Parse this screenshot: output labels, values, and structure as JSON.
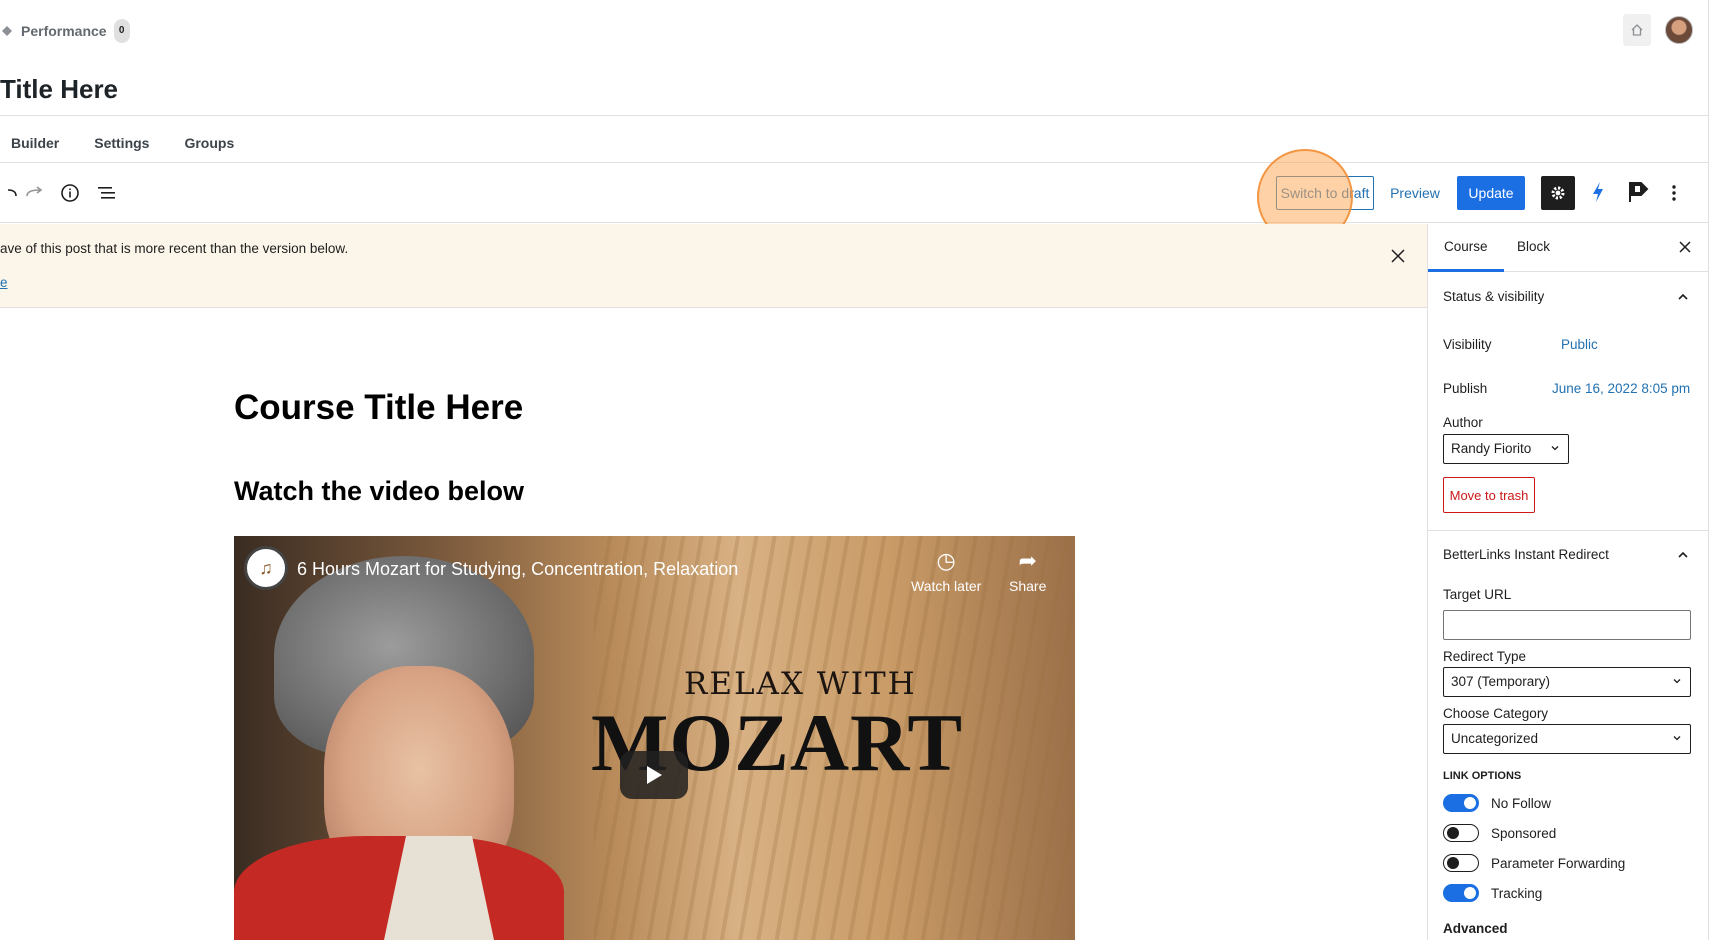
{
  "admin_bar": {
    "performance_label": "Performance",
    "performance_count": "0"
  },
  "page": {
    "title": "Title Here"
  },
  "tabs": [
    "Builder",
    "Settings",
    "Groups"
  ],
  "toolbar": {
    "switch_to_draft": "Switch to draft",
    "preview": "Preview",
    "update": "Update"
  },
  "notice": {
    "message": "ave of this post that is more recent than the version below.",
    "link": "e"
  },
  "content": {
    "heading": "Course Title Here",
    "subheading": "Watch the video below",
    "video": {
      "title": "6 Hours Mozart for Studying, Concentration, Relaxation",
      "watch_later": "Watch later",
      "share": "Share",
      "thumbnail_line1": "RELAX WITH",
      "thumbnail_line2": "MOZART"
    }
  },
  "sidebar": {
    "tabs": {
      "course": "Course",
      "block": "Block"
    },
    "status": {
      "heading": "Status & visibility",
      "visibility_label": "Visibility",
      "visibility_value": "Public",
      "publish_label": "Publish",
      "publish_value": "June 16, 2022 8:05 pm",
      "author_label": "Author",
      "author_value": "Randy Fiorito",
      "trash": "Move to trash"
    },
    "betterlinks": {
      "heading": "BetterLinks Instant Redirect",
      "target_url_label": "Target URL",
      "target_url_value": "",
      "redirect_type_label": "Redirect Type",
      "redirect_type_value": "307 (Temporary)",
      "category_label": "Choose Category",
      "category_value": "Uncategorized",
      "link_options_label": "LINK OPTIONS",
      "options": [
        {
          "label": "No Follow",
          "on": true
        },
        {
          "label": "Sponsored",
          "on": false
        },
        {
          "label": "Parameter Forwarding",
          "on": false
        },
        {
          "label": "Tracking",
          "on": true
        }
      ],
      "advanced": "Advanced"
    }
  },
  "colors": {
    "accent": "#1b6fe2",
    "notice_bg": "#fcf6ea",
    "danger": "#cc1818",
    "highlight": "#ffac5c"
  }
}
